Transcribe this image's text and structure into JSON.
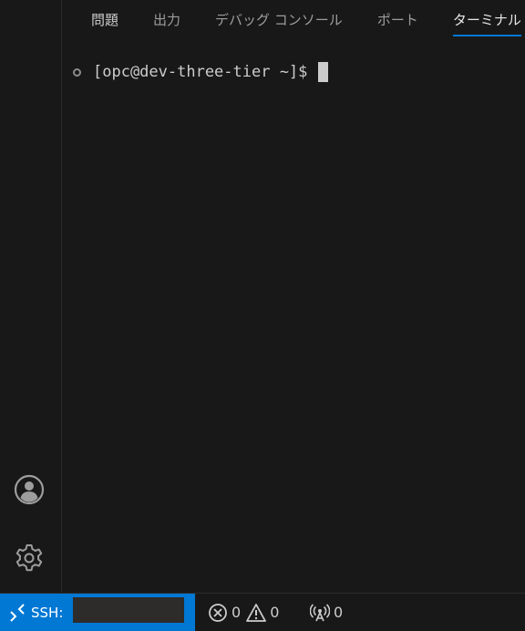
{
  "panel": {
    "tabs": [
      {
        "label": "問題"
      },
      {
        "label": "出力"
      },
      {
        "label": "デバッグ コンソール"
      },
      {
        "label": "ポート"
      },
      {
        "label": "ターミナル",
        "active": true
      }
    ]
  },
  "terminal": {
    "prompt": "[opc@dev-three-tier ~]$"
  },
  "activity_bar": {
    "icons": [
      "account-icon",
      "settings-gear-icon"
    ]
  },
  "statusbar": {
    "remote": {
      "label": "SSH:",
      "host": ""
    },
    "errors": "0",
    "warnings": "0",
    "ports": "0"
  },
  "colors": {
    "background": "#181818",
    "accent": "#0078d4",
    "text": "#cccccc"
  }
}
